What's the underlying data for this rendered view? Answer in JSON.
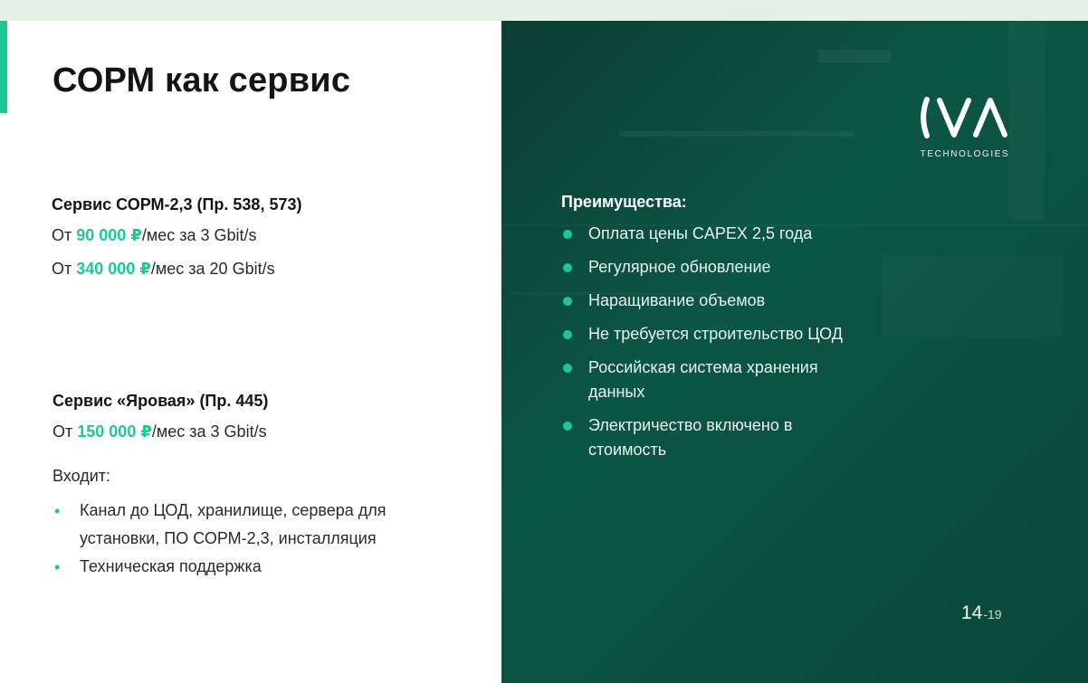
{
  "slide": {
    "title": "СОРМ как сервис"
  },
  "sorm_service": {
    "title": "Сервис СОРМ-2,3 (Пр. 538, 573)",
    "lines": [
      {
        "prefix": "От",
        "price": "90 000",
        "currency": "₽",
        "suffix": "/мес за 3 Gbit/s"
      },
      {
        "prefix": "От",
        "price": "340 000",
        "currency": "₽",
        "suffix": "/мес за 20 Gbit/s"
      }
    ]
  },
  "yarovaya_service": {
    "title": "Сервис «Яровая» (Пр. 445)",
    "line": {
      "prefix": "От",
      "price": "150 000",
      "currency": "₽",
      "suffix": "/мес за 3 Gbit/s"
    },
    "includes_label": "Входит:",
    "includes": [
      "Канал до ЦОД, хранилище, сервера для установки, ПО СОРМ-2,3, инсталляция",
      "Техническая поддержка"
    ]
  },
  "advantages": {
    "title": "Преимущества:",
    "items": [
      "Оплата цены CAPEX 2,5 года",
      "Регулярное обновление",
      "Наращивание объемов",
      "Не требуется строительство ЦОД",
      "Российская система хранения данных",
      "Электричество включено в стоимость"
    ]
  },
  "logo": {
    "subtitle": "TECHNOLOGIES"
  },
  "page": {
    "current": "14",
    "total": "-19"
  },
  "colors": {
    "accent": "#1ec896",
    "panel_dark": "#0b5644",
    "topbar": "#e4f2e6"
  }
}
